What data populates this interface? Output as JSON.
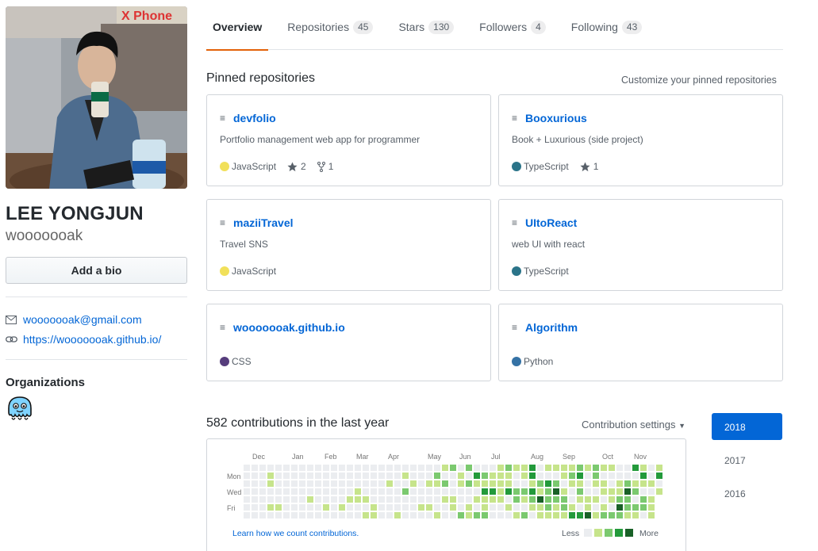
{
  "profile": {
    "fullname": "LEE YONGJUN",
    "username": "wooooooak",
    "add_bio_label": "Add a bio",
    "email": "wooooooak@gmail.com",
    "website": "https://wooooooak.github.io/",
    "photo_sign_text": "X Phone"
  },
  "organizations": {
    "heading": "Organizations"
  },
  "tabs": [
    {
      "label": "Overview",
      "count": null,
      "selected": true
    },
    {
      "label": "Repositories",
      "count": "45"
    },
    {
      "label": "Stars",
      "count": "130"
    },
    {
      "label": "Followers",
      "count": "4"
    },
    {
      "label": "Following",
      "count": "43"
    }
  ],
  "pinned": {
    "title": "Pinned repositories",
    "customize_label": "Customize your pinned repositories",
    "repos": [
      {
        "name": "devfolio",
        "description": "Portfolio management web app for programmer",
        "language": "JavaScript",
        "language_color": "#f1e05a",
        "stars": "2",
        "forks": "1"
      },
      {
        "name": "Booxurious",
        "description": "Book + Luxurious (side project)",
        "language": "TypeScript",
        "language_color": "#2b7489",
        "stars": "1",
        "forks": null
      },
      {
        "name": "maziiTravel",
        "description": "Travel SNS",
        "language": "JavaScript",
        "language_color": "#f1e05a",
        "stars": null,
        "forks": null
      },
      {
        "name": "UItoReact",
        "description": "web UI with react",
        "language": "TypeScript",
        "language_color": "#2b7489",
        "stars": null,
        "forks": null
      },
      {
        "name": "wooooooak.github.io",
        "description": "",
        "language": "CSS",
        "language_color": "#563d7c",
        "stars": null,
        "forks": null
      },
      {
        "name": "Algorithm",
        "description": "",
        "language": "Python",
        "language_color": "#3572A5",
        "stars": null,
        "forks": null
      }
    ]
  },
  "contributions": {
    "title": "582 contributions in the last year",
    "settings_label": "Contribution settings",
    "months": [
      "Dec",
      "Jan",
      "Feb",
      "Mar",
      "Apr",
      "May",
      "Jun",
      "Jul",
      "Aug",
      "Sep",
      "Oct",
      "Nov"
    ],
    "days": [
      "Mon",
      "Wed",
      "Fri"
    ],
    "learn_label": "Learn how we count contributions.",
    "legend_less": "Less",
    "legend_more": "More",
    "level_colors": [
      "#ebedf0",
      "#c6e48b",
      "#7bc96f",
      "#239a3b",
      "#196127"
    ],
    "years": [
      {
        "label": "2018",
        "selected": true
      },
      {
        "label": "2017"
      },
      {
        "label": "2016"
      }
    ]
  }
}
